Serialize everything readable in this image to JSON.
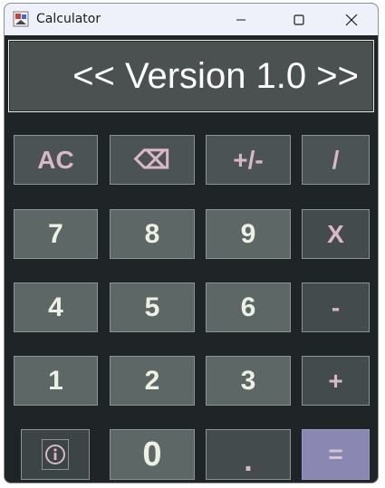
{
  "window": {
    "title": "Calculator",
    "icons": {
      "app": "calculator-app-icon",
      "minimize": "minimize-icon",
      "maximize": "maximize-icon",
      "close": "close-icon"
    }
  },
  "display": {
    "text": "<< Version 1.0 >>"
  },
  "keys": {
    "clear": "AC",
    "backspace": "⌫",
    "sign": "+/-",
    "divide": "/",
    "seven": "7",
    "eight": "8",
    "nine": "9",
    "multiply": "X",
    "four": "4",
    "five": "5",
    "six": "6",
    "subtract": "-",
    "one": "1",
    "two": "2",
    "three": "3",
    "add": "+",
    "info_icon": "info-icon",
    "zero": "0",
    "decimal": ".",
    "equals": "="
  },
  "colors": {
    "background": "#1f2426",
    "display": "#4b5051",
    "number_key": "#5d6866",
    "function_key": "#4b5354",
    "operator_key": "#434b4c",
    "equals_key": "#8a87b2",
    "key_text_light": "#eef0e4",
    "key_text_pink": "#d8b8c4"
  }
}
